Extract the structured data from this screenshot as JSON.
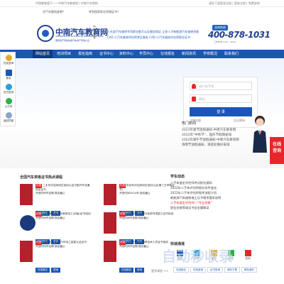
{
  "topbar": {
    "left_text": "中国教育版下——中南汽车教育网 | 中南汽车院校",
    "right_text": "请在下面登录注册 | 登录注册 | 免费咨询"
  },
  "subbar": {
    "link1": "学汽车要找谁啊？",
    "link2": "考到国家职业资格证书？"
  },
  "header": {
    "logo_cn": "中南汽车教育网",
    "logo_en": "CENTRAL SOUTH AUTOMOTIVE EDUCATION NETWORK",
    "logo_sub": "国家资产评估协会汽车资产评估认证",
    "vertical_text": "中南教育",
    "mid_lines": [
      "人社部汽车维修专项职业能力认证服务保证 让你人才新能源汽车维修技能",
      "CAD 小汽车维修评估师考证服务 CAD 小汽车维修评估师职业证书"
    ],
    "phone_badge": "咨询热线",
    "phone": "400-878-1031",
    "hours": "工作时间 9:00 - 18:00"
  },
  "nav": {
    "items": [
      "网站首页",
      "培训项目",
      "报名指南",
      "证书中心",
      "资料中心",
      "学员中心",
      "在线报名",
      "新闻资讯",
      "学校概况",
      "联系我们"
    ],
    "active_index": 0
  },
  "left_side": {
    "items": [
      "在线咨询",
      "报名",
      "证书查询",
      "公众号",
      "返回顶部"
    ]
  },
  "login": {
    "user_placeholder": "用户名/手机",
    "pass_placeholder": "密码",
    "submit": "登 录",
    "register": "立即注册",
    "forgot": "忘记密码"
  },
  "chat": {
    "label1": "在线",
    "label2": "咨询"
  },
  "news": {
    "title": "热门新闻",
    "items": [
      "2023年春节放假通知-中南汽车教育网",
      "2022年“中秋节”、国庆节假期安排",
      "2022年端午节放假通知-中南汽车教育网",
      "清明节放假通知，请提前做好安排"
    ]
  },
  "products": {
    "title": "全国汽车资格证书热点课程",
    "items": [
      {
        "tag": "热报",
        "title": "二手车评估师岗位培训认证中国汽车流通协会证书",
        "desc": "开班时间不定期 报名截止",
        "hl": "报名截止",
        "btn1": "在线报名",
        "btn2": "咨询"
      },
      {
        "tag": "热报",
        "title": "机动车评估师岗位培训认证(第三方考核证书)",
        "desc": "开班时间2024年 报名截止",
        "hl": "报名截止",
        "btn1": "在线报名",
        "btn2": "咨询"
      },
      {
        "tag": "热报",
        "title": "2024新能源汽车维修电工(初级)证书培训",
        "desc": "开班时间不定期 报名截止",
        "hl": "报名截止",
        "btn1": "在线报名",
        "btn2": "咨询"
      },
      {
        "tag": "热报",
        "title": "新能源汽车维修与检测专项能力证书培训",
        "desc": "开班时间不定期 报名截止",
        "hl": "报名截止",
        "btn1": "在线报名",
        "btn2": "咨询"
      },
      {
        "tag": "热报",
        "title": "新能源(汽车类)汽车电工技能认证证书",
        "desc": "开班时间不定期 报名截止",
        "hl": "报名截止",
        "btn1": "在线报名",
        "btn2": "咨询"
      },
      {
        "tag": "热报",
        "title": "全国汽车检测维修技术人员证书培训",
        "desc": "开班时间不定期 报名截止",
        "hl": "报名截止",
        "btn1": "在线报名",
        "btn2": "咨询"
      }
    ],
    "more": "更多课程 >>"
  },
  "study": {
    "title": "学车动态",
    "lines": [
      "二手车鉴定评估师考试报名通知",
      "2022年二手车评估师报名条件变化",
      "2022年二手车评估师报考流程介绍",
      "新能源汽车维修电工证书报考要求说明",
      "二手车鉴定评估师一“专业资格”",
      "职业技能等级证书含金量解读"
    ],
    "red_index": 4
  },
  "quick": {
    "title": "快速通道",
    "items": [
      "报名",
      "学员",
      "证书",
      "考试",
      "咨询"
    ],
    "buttons": [
      "在线报名",
      "在线咨询",
      "证书查询",
      "资料下载",
      "联系我们"
    ]
  },
  "watermark": "自动秒收录",
  "colors": {
    "brand": "#1a56b6",
    "accent_red": "#e8262a"
  }
}
